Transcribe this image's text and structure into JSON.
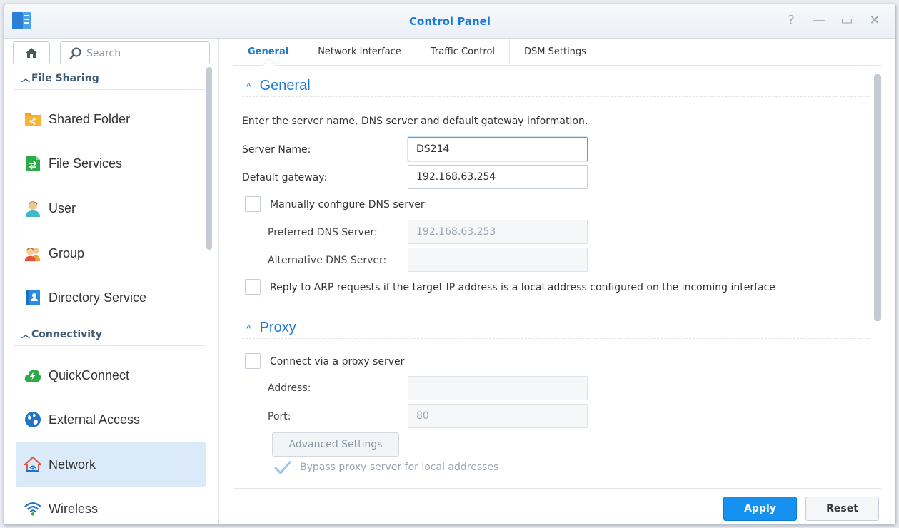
{
  "window": {
    "title": "Control Panel",
    "help_glyph": "?",
    "minimize_glyph": "—",
    "maximize_glyph": "▭",
    "close_glyph": "✕"
  },
  "sidebar": {
    "search_placeholder": "Search",
    "sections": [
      {
        "label": "File Sharing"
      },
      {
        "label": "Connectivity"
      }
    ],
    "items": [
      {
        "label": "Shared Folder",
        "icon": "shared-folder-icon"
      },
      {
        "label": "File Services",
        "icon": "file-services-icon"
      },
      {
        "label": "User",
        "icon": "user-icon"
      },
      {
        "label": "Group",
        "icon": "group-icon"
      },
      {
        "label": "Directory Service",
        "icon": "directory-service-icon"
      },
      {
        "label": "QuickConnect",
        "icon": "quickconnect-icon"
      },
      {
        "label": "External Access",
        "icon": "external-access-icon"
      },
      {
        "label": "Network",
        "icon": "network-icon",
        "active": true
      },
      {
        "label": "Wireless",
        "icon": "wireless-icon"
      }
    ]
  },
  "tabs": [
    {
      "label": "General",
      "active": true
    },
    {
      "label": "Network Interface"
    },
    {
      "label": "Traffic Control"
    },
    {
      "label": "DSM Settings"
    }
  ],
  "general": {
    "heading": "General",
    "description": "Enter the server name, DNS server and default gateway information.",
    "server_name_label": "Server Name:",
    "server_name_value": "DS214",
    "gateway_label": "Default gateway:",
    "gateway_value": "192.168.63.254",
    "manual_dns_label": "Manually configure DNS server",
    "manual_dns_checked": false,
    "preferred_dns_label": "Preferred DNS Server:",
    "preferred_dns_value": "192.168.63.253",
    "alternative_dns_label": "Alternative DNS Server:",
    "alternative_dns_value": "",
    "arp_label": "Reply to ARP requests if the target IP address is a local address configured on the incoming interface",
    "arp_checked": false
  },
  "proxy": {
    "heading": "Proxy",
    "connect_label": "Connect via a proxy server",
    "connect_checked": false,
    "address_label": "Address:",
    "address_value": "",
    "port_label": "Port:",
    "port_value": "80",
    "advanced_label": "Advanced Settings",
    "bypass_label": "Bypass proxy server for local addresses",
    "bypass_checked": true
  },
  "footer": {
    "apply_label": "Apply",
    "reset_label": "Reset"
  },
  "colors": {
    "accent": "#1c7ad9",
    "apply_button": "#1591f0",
    "active_nav_bg": "#dbeaf8"
  }
}
